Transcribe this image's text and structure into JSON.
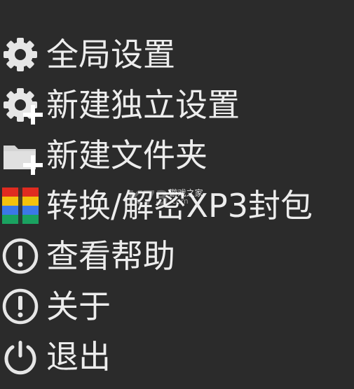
{
  "menu": {
    "items": [
      {
        "label": "全局设置",
        "icon": "gear-icon"
      },
      {
        "label": "新建独立设置",
        "icon": "gear-plus-icon"
      },
      {
        "label": "新建文件夹",
        "icon": "folder-plus-icon"
      },
      {
        "label": "转换/解密XP3封包",
        "icon": "xp3-package-icon"
      },
      {
        "label": "查看帮助",
        "icon": "exclamation-circle-icon"
      },
      {
        "label": "关于",
        "icon": "exclamation-circle-icon"
      },
      {
        "label": "退出",
        "icon": "power-icon"
      }
    ]
  },
  "watermark": {
    "logo": "K73",
    "site_name": "游戏之家",
    "domain": ".com"
  },
  "colors": {
    "background": "#2b2b2b",
    "text": "#ededed",
    "icon": "#e6e6e6",
    "folder": "#d4d4d4",
    "xp3_red": "#e02b20",
    "xp3_yellow": "#f4c20d",
    "xp3_blue": "#3b78e7",
    "xp3_green": "#1aa260"
  }
}
